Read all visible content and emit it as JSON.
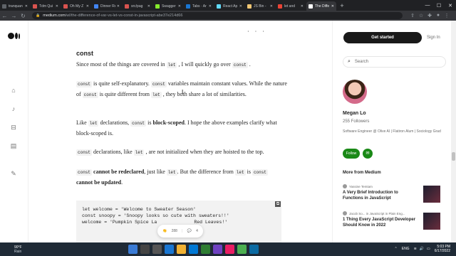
{
  "browser": {
    "tabs": [
      {
        "label": "tranquan",
        "color": "#5f6368",
        "active": false
      },
      {
        "label": "Tdm Qui",
        "color": "#d9534f",
        "active": false
      },
      {
        "label": "Oh My Z",
        "color": "#d9534f",
        "active": false
      },
      {
        "label": "Dinner Re",
        "color": "#4285f4",
        "active": false
      },
      {
        "label": "src/pag",
        "color": "#d9534f",
        "active": false
      },
      {
        "label": "Swagger",
        "color": "#85ea2d",
        "active": false
      },
      {
        "label": "Tabs · Ar",
        "color": "#1976d2",
        "active": false
      },
      {
        "label": "React Ap",
        "color": "#61dafb",
        "active": false
      },
      {
        "label": "JS Bin -",
        "color": "#f0c674",
        "active": false
      },
      {
        "label": "let and",
        "color": "#ea4335",
        "active": false
      },
      {
        "label": "The Diffe",
        "color": "#ffffff",
        "active": true
      }
    ],
    "url_host": "medium.com",
    "url_path": "/wl/the-difference-of-var-vs-let-vs-const-in-javascript-abe37e214d66"
  },
  "article": {
    "dots": "· · ·",
    "heading": "const",
    "p1_a": "Since most of the things are covered in ",
    "p1_code1": "let",
    "p1_b": " , I will quickly go over ",
    "p1_code2": "const",
    "p1_c": " .",
    "p2_code1": "const",
    "p2_a": " is quite self-explanatory. ",
    "p2_code2": "const",
    "p2_b": " variables maintain constant values. While the nature of ",
    "p2_code3": "const",
    "p2_c": " is quite different from ",
    "p2_code4": "let",
    "p2_d": " , they both share a lot of similarities.",
    "p3_a": "Like ",
    "p3_code1": "let",
    "p3_b": " declarations, ",
    "p3_code2": "const",
    "p3_c": " is ",
    "p3_bold": "block-scoped",
    "p3_d": ". I hope the above examples clarify what block-scoped is.",
    "p4_code1": "const",
    "p4_a": " declarations, like ",
    "p4_code2": "let",
    "p4_b": " , are not initialized when they are hoisted to the top.",
    "p5_code1": "const",
    "p5_bold1": " cannot be redeclared",
    "p5_a": ", just like ",
    "p5_code2": "let",
    "p5_b": ". But the difference from ",
    "p5_code3": "let",
    "p5_c": " is ",
    "p5_code4": "const",
    "p5_bold2": "cannot be updated",
    "p5_d": ".",
    "code_line1": "let welcome = 'Welcome to Sweater Season'",
    "code_line2": "const snoopy = 'Snoopy looks so cute with sweaters!!'",
    "code_line3": "",
    "code_line4": "welcome = 'Pumpkin Spice La",
    "code_line4_tail": "Red Leaves!'",
    "claps": "288",
    "responses": "4"
  },
  "sidebar": {
    "get_started": "Get started",
    "sign_in": "Sign In",
    "search_placeholder": "Search",
    "author_name": "Megan Lo",
    "followers": "255 Followers",
    "bio": "Software Engineer @ Olive AI | Flatiron Alum | Sociology Grad",
    "follow": "Follow",
    "more_from": "More from Medium",
    "recs": [
      {
        "author": "Yassine Temtam",
        "title": "A Very Brief Introduction to Functions in JavaScript"
      },
      {
        "author": "Jacob So... in JavaScript in Plain Eng...",
        "title": "1 Thing Every JavaScript Developer Should Know in 2022"
      }
    ]
  },
  "taskbar": {
    "temp": "90°F",
    "weather": "Rain",
    "lang": "ENG",
    "time": "5:03 PM",
    "date": "6/17/2022"
  }
}
